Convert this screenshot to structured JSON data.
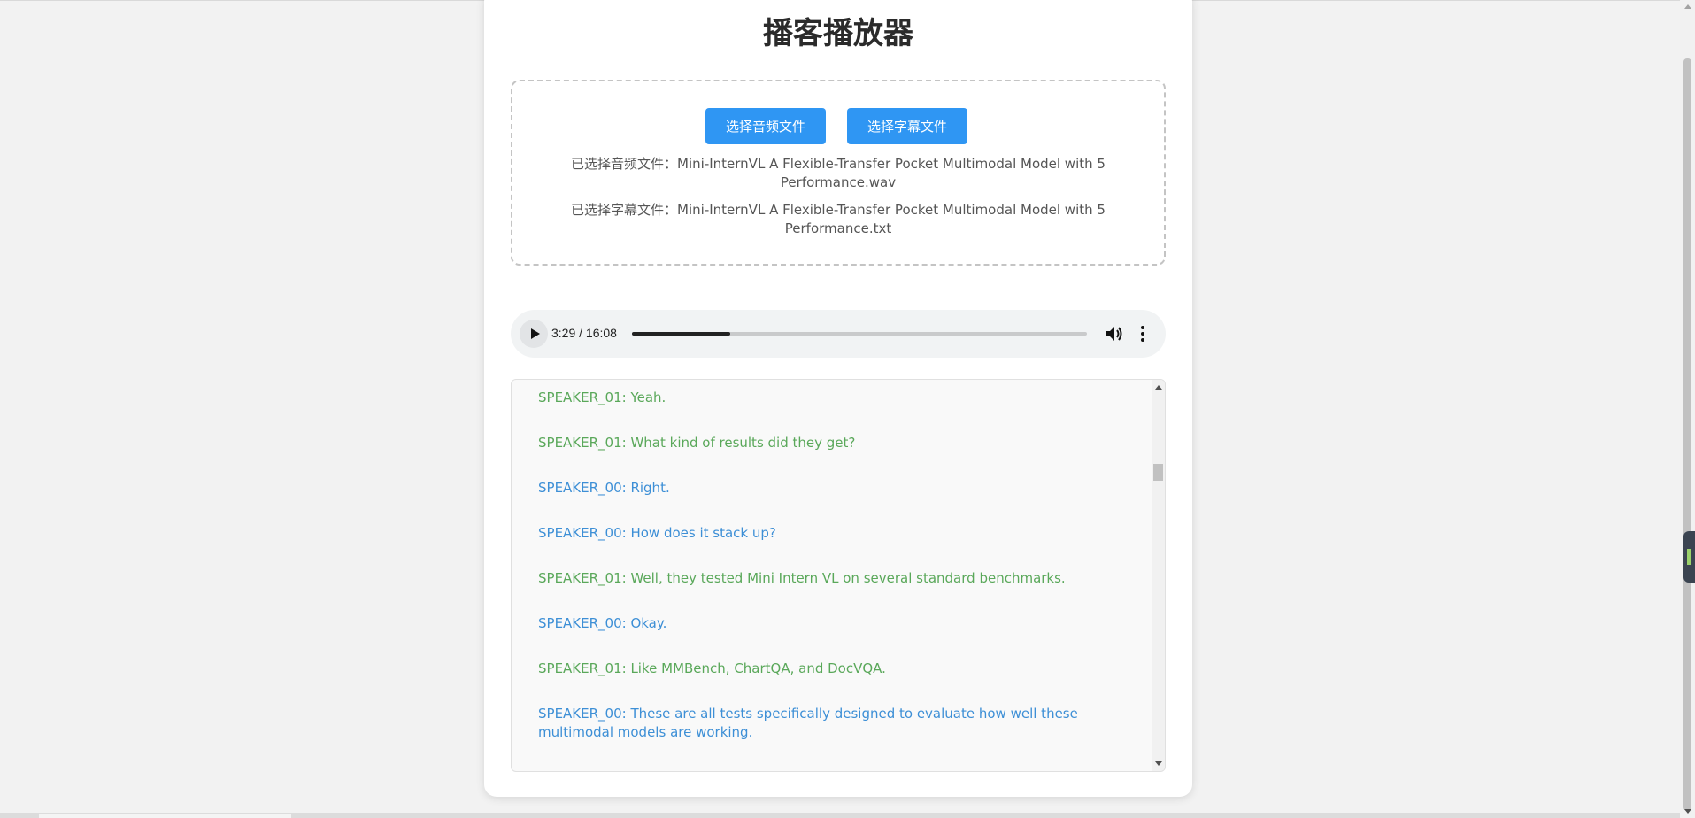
{
  "page": {
    "title": "播客播放器"
  },
  "upload": {
    "audio_button_label": "选择音频文件",
    "subtitle_button_label": "选择字幕文件",
    "audio_file_text": "已选择音频文件：Mini-InternVL A Flexible-Transfer Pocket Multimodal Model with 5 Performance.wav",
    "subtitle_file_text": "已选择字幕文件：Mini-InternVL A Flexible-Transfer Pocket Multimodal Model with 5 Performance.txt"
  },
  "player": {
    "time_display": "3:29 / 16:08",
    "progress_fraction": 0.216,
    "play_icon": "play-icon",
    "volume_icon": "volume-icon",
    "more_icon": "more-options-icon"
  },
  "transcript": {
    "lines": [
      {
        "speaker": "SPEAKER_01",
        "text": "SPEAKER_01: Yeah."
      },
      {
        "speaker": "SPEAKER_01",
        "text": "SPEAKER_01: What kind of results did they get?"
      },
      {
        "speaker": "SPEAKER_00",
        "text": "SPEAKER_00: Right."
      },
      {
        "speaker": "SPEAKER_00",
        "text": "SPEAKER_00: How does it stack up?"
      },
      {
        "speaker": "SPEAKER_01",
        "text": "SPEAKER_01: Well, they tested Mini Intern VL on several standard benchmarks."
      },
      {
        "speaker": "SPEAKER_00",
        "text": "SPEAKER_00: Okay."
      },
      {
        "speaker": "SPEAKER_01",
        "text": "SPEAKER_01: Like MMBench, ChartQA, and DocVQA."
      },
      {
        "speaker": "SPEAKER_00",
        "text": "SPEAKER_00: These are all tests specifically designed to evaluate how well these multimodal models are working."
      }
    ]
  },
  "colors": {
    "primary_button": "#2f96f3",
    "speaker_00": "#3d8fd6",
    "speaker_01": "#5aa85a"
  }
}
